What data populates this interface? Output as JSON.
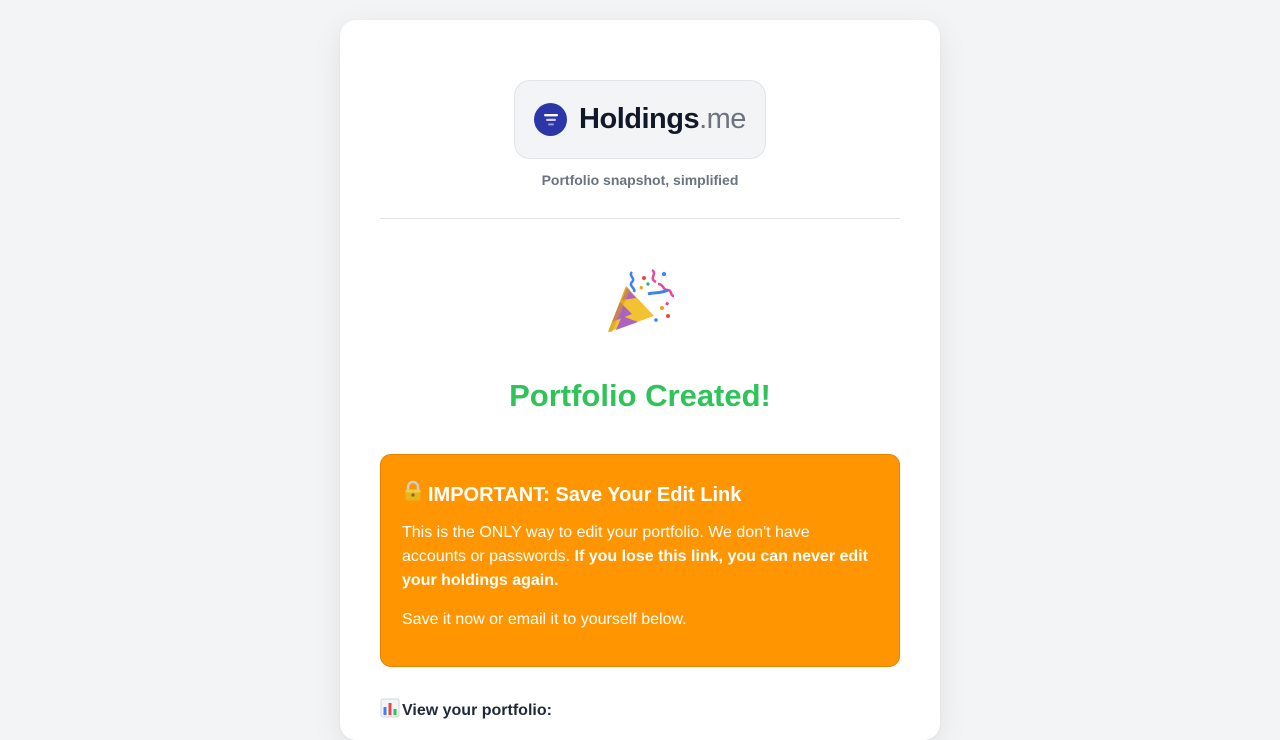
{
  "brand": {
    "name": "Holdings",
    "tld": ".me",
    "tagline": "Portfolio snapshot, simplified",
    "icon": "stacked-lines-icon",
    "color": "#2c36a8"
  },
  "success": {
    "icon": "party-popper-icon",
    "title": "Portfolio Created!",
    "color": "#2fc35a"
  },
  "warning": {
    "icon": "lock-icon",
    "title": "IMPORTANT: Save Your Edit Link",
    "body_plain": "This is the ONLY way to edit your portfolio. We don't have accounts or passwords.",
    "body_bold": "If you lose this link, you can never edit your holdings again.",
    "note": "Save it now or email it to yourself below.",
    "color": "#ff9500"
  },
  "view": {
    "icon": "bar-chart-icon",
    "label": "View your portfolio:"
  }
}
